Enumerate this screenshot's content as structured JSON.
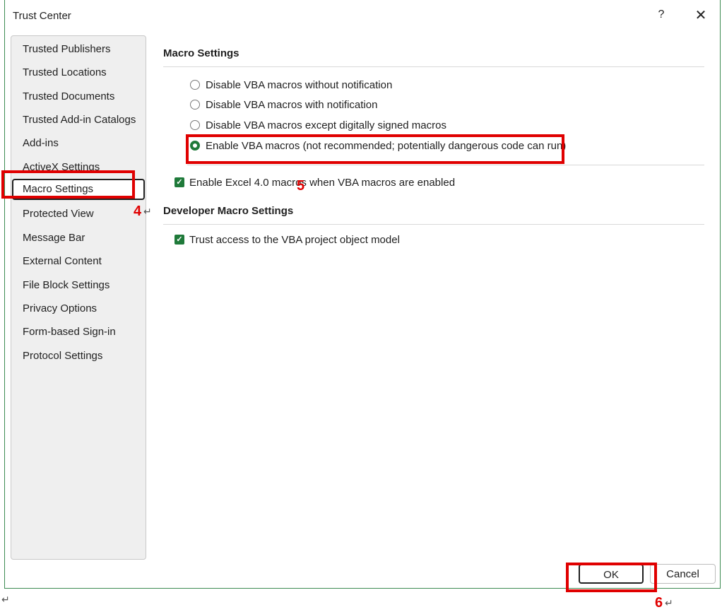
{
  "window": {
    "title": "Trust Center",
    "help_label": "?",
    "close_label": "✕"
  },
  "sidebar": {
    "items": [
      {
        "label": "Trusted Publishers"
      },
      {
        "label": "Trusted Locations"
      },
      {
        "label": "Trusted Documents"
      },
      {
        "label": "Trusted Add-in Catalogs"
      },
      {
        "label": "Add-ins"
      },
      {
        "label": "ActiveX Settings"
      },
      {
        "label": "Macro Settings",
        "selected": true
      },
      {
        "label": "Protected View"
      },
      {
        "label": "Message Bar"
      },
      {
        "label": "External Content"
      },
      {
        "label": "File Block Settings"
      },
      {
        "label": "Privacy Options"
      },
      {
        "label": "Form-based Sign-in"
      },
      {
        "label": "Protocol Settings"
      }
    ]
  },
  "macro_settings": {
    "title": "Macro Settings",
    "options": [
      {
        "label": "Disable VBA macros without notification",
        "checked": false
      },
      {
        "label": "Disable VBA macros with notification",
        "checked": false
      },
      {
        "label": "Disable VBA macros except digitally signed macros",
        "checked": false
      },
      {
        "label": "Enable VBA macros (not recommended; potentially dangerous code can run)",
        "checked": true
      }
    ],
    "excel4_label": "Enable Excel 4.0 macros when VBA macros are enabled",
    "excel4_checked": true
  },
  "developer_settings": {
    "title": "Developer Macro Settings",
    "trust_vba_label": "Trust access to the VBA project object model",
    "trust_vba_checked": true
  },
  "buttons": {
    "ok_label": "OK",
    "cancel_label": "Cancel"
  },
  "annotations": {
    "step4": "4",
    "step5": "5",
    "step6": "6",
    "highlight_color": "#e00000"
  },
  "colors": {
    "accent": "#1f7a3a",
    "window_border": "#3c8b52"
  }
}
